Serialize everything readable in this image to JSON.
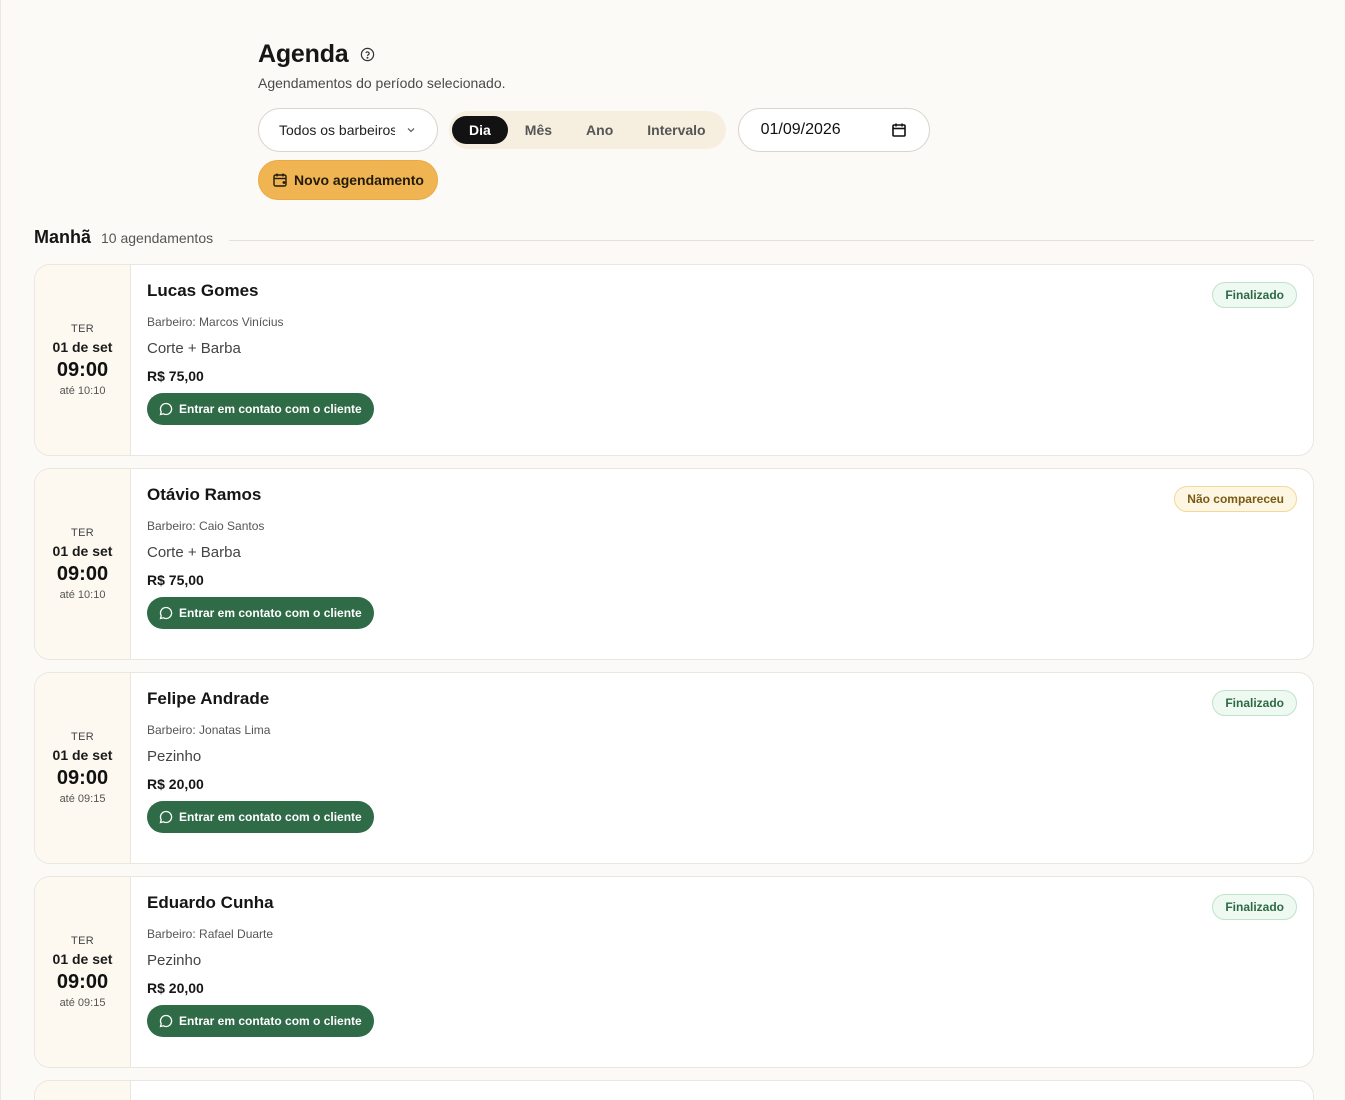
{
  "header": {
    "title": "Agenda",
    "subtitle": "Agendamentos do período selecionado."
  },
  "filters": {
    "barber_select": "Todos os barbeiros",
    "view_modes": [
      "Dia",
      "Mês",
      "Ano",
      "Intervalo"
    ],
    "active_view": "Dia",
    "date_value": "01/09/2026"
  },
  "actions": {
    "new_appointment": "Novo agendamento"
  },
  "section": {
    "title": "Manhã",
    "count": "10 agendamentos"
  },
  "appointments": [
    {
      "dow": "TER",
      "date": "01 de set",
      "time": "09:00",
      "until": "até 10:10",
      "client": "Lucas Gomes",
      "barber": "Barbeiro: Marcos Vinícius",
      "service": "Corte + Barba",
      "price": "R$ 75,00",
      "contact": "Entrar em contato com o cliente",
      "status": "Finalizado",
      "status_type": "done"
    },
    {
      "dow": "TER",
      "date": "01 de set",
      "time": "09:00",
      "until": "até 10:10",
      "client": "Otávio Ramos",
      "barber": "Barbeiro: Caio Santos",
      "service": "Corte + Barba",
      "price": "R$ 75,00",
      "contact": "Entrar em contato com o cliente",
      "status": "Não compareceu",
      "status_type": "noshow"
    },
    {
      "dow": "TER",
      "date": "01 de set",
      "time": "09:00",
      "until": "até 09:15",
      "client": "Felipe Andrade",
      "barber": "Barbeiro: Jonatas Lima",
      "service": "Pezinho",
      "price": "R$ 20,00",
      "contact": "Entrar em contato com o cliente",
      "status": "Finalizado",
      "status_type": "done"
    },
    {
      "dow": "TER",
      "date": "01 de set",
      "time": "09:00",
      "until": "até 09:15",
      "client": "Eduardo Cunha",
      "barber": "Barbeiro: Rafael Duarte",
      "service": "Pezinho",
      "price": "R$ 20,00",
      "contact": "Entrar em contato com o cliente",
      "status": "Finalizado",
      "status_type": "done"
    }
  ],
  "colors": {
    "accent": "#f0b552",
    "contact_green": "#2f6b47",
    "active_tab": "#121212",
    "background": "#fcfaf6"
  },
  "icons": {
    "help": "help-circle-icon",
    "chevron": "chevron-down-icon",
    "calendar": "calendar-icon",
    "new": "calendar-plus-icon",
    "chat": "chat-bubble-icon"
  }
}
